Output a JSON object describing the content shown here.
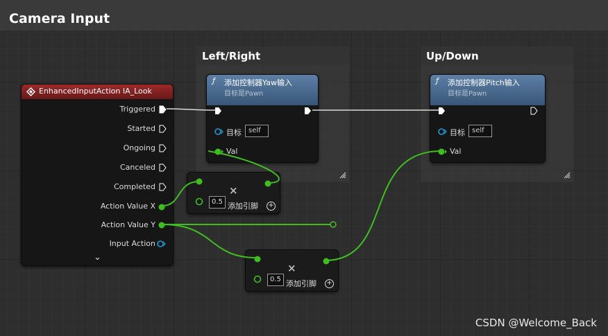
{
  "comment": {
    "title": "Camera Input"
  },
  "groups": {
    "left_right": "Left/Right",
    "up_down": "Up/Down"
  },
  "event_node": {
    "title": "EnhancedInputAction IA_Look",
    "pins": [
      "Triggered",
      "Started",
      "Ongoing",
      "Canceled",
      "Completed",
      "Action Value X",
      "Action Value Y",
      "Input Action"
    ],
    "expand_glyph": "⌄"
  },
  "yaw_node": {
    "icon": "ƒ",
    "title": "添加控制器Yaw输入",
    "subtitle": "目标是Pawn",
    "target_label": "目标",
    "target_value": "self",
    "val_label": "Val"
  },
  "pitch_node": {
    "icon": "ƒ",
    "title": "添加控制器Pitch输入",
    "subtitle": "目标是Pawn",
    "target_label": "目标",
    "target_value": "self",
    "val_label": "Val"
  },
  "multiply_node_1": {
    "operator": "×",
    "value": "0.5",
    "add_pin_label": "添加引脚",
    "plus": "+"
  },
  "multiply_node_2": {
    "operator": "×",
    "value": "0.5",
    "add_pin_label": "添加引脚",
    "plus": "+"
  },
  "watermark": "CSDN @Welcome_Back",
  "colors": {
    "exec": "#ffffff",
    "float_pin": "#3fbf1f",
    "object_pin": "#1b9bd3",
    "event_header": "#9c2a2a",
    "function_header": "#5d7fa6"
  }
}
